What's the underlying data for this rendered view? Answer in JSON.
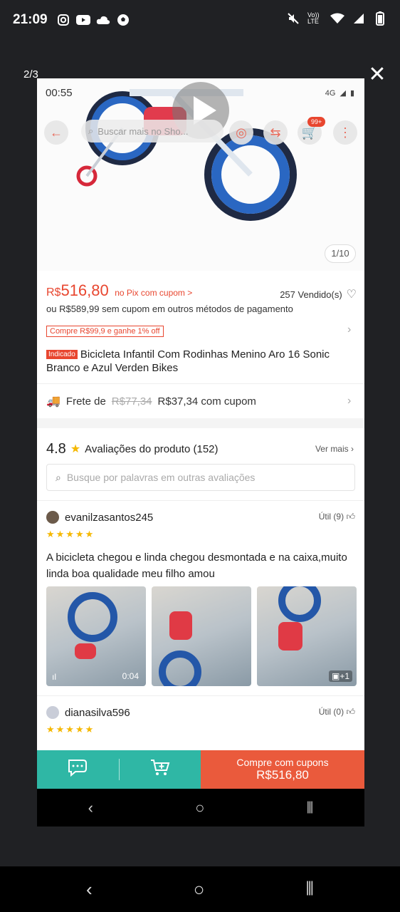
{
  "os_status": {
    "time": "21:09",
    "left_icons": [
      "instagram-icon",
      "youtube-icon",
      "cloud-icon",
      "soccer-icon"
    ],
    "right_icons": [
      "mute-icon",
      "volte-icon",
      "wifi-icon",
      "signal-icon",
      "battery-icon"
    ],
    "volte_text": "Vo)) LTE"
  },
  "viewer": {
    "counter": "2/3",
    "close_icon": "close-icon"
  },
  "inner_status": {
    "time": "00:55",
    "network": "4G"
  },
  "top_nav": {
    "search_placeholder": "Buscar mais no Sho...",
    "cart_badge": "99+"
  },
  "gallery": {
    "page_indicator": "1/10"
  },
  "product": {
    "currency": "R$",
    "price": "516,80",
    "pix_label": "no Pix com cupom >",
    "sold": "257 Vendido(s)",
    "alt_price": "ou R$589,99 sem cupom em outros métodos de pagamento",
    "coupon_tag": "Compre R$99,9 e ganhe 1% off",
    "badge": "Indicado",
    "title": "Bicicleta Infantil Com Rodinhas Menino Aro 16 Sonic Branco e Azul Verden Bikes"
  },
  "shipping": {
    "label": "Frete de",
    "old_price": "R$77,34",
    "new_price": "R$37,34 com cupom"
  },
  "reviews": {
    "rating": "4.8",
    "label": "Avaliações do produto (152)",
    "see_more": "Ver mais",
    "search_placeholder": "Busque por palavras em outras avaliações",
    "items": [
      {
        "user": "evanilzasantos245",
        "helpful": "Útil (9)",
        "stars": "★★★★★",
        "text": "A bicicleta chegou e linda  chegou desmontada e na caixa,muito linda boa qualidade meu filho amou",
        "video_duration": "0:04",
        "extra_photos": "+1"
      },
      {
        "user": "dianasilva596",
        "helpful": "Útil (0)",
        "stars": "★★★★★"
      }
    ]
  },
  "bottom_bar": {
    "buy_line1": "Compre com cupons",
    "buy_line2": "R$516,80"
  },
  "colors": {
    "accent": "#e8462f",
    "teal": "#2fb7a5",
    "buy": "#ea5a3c",
    "star": "#f5b800",
    "viewer_bg": "#202124"
  }
}
